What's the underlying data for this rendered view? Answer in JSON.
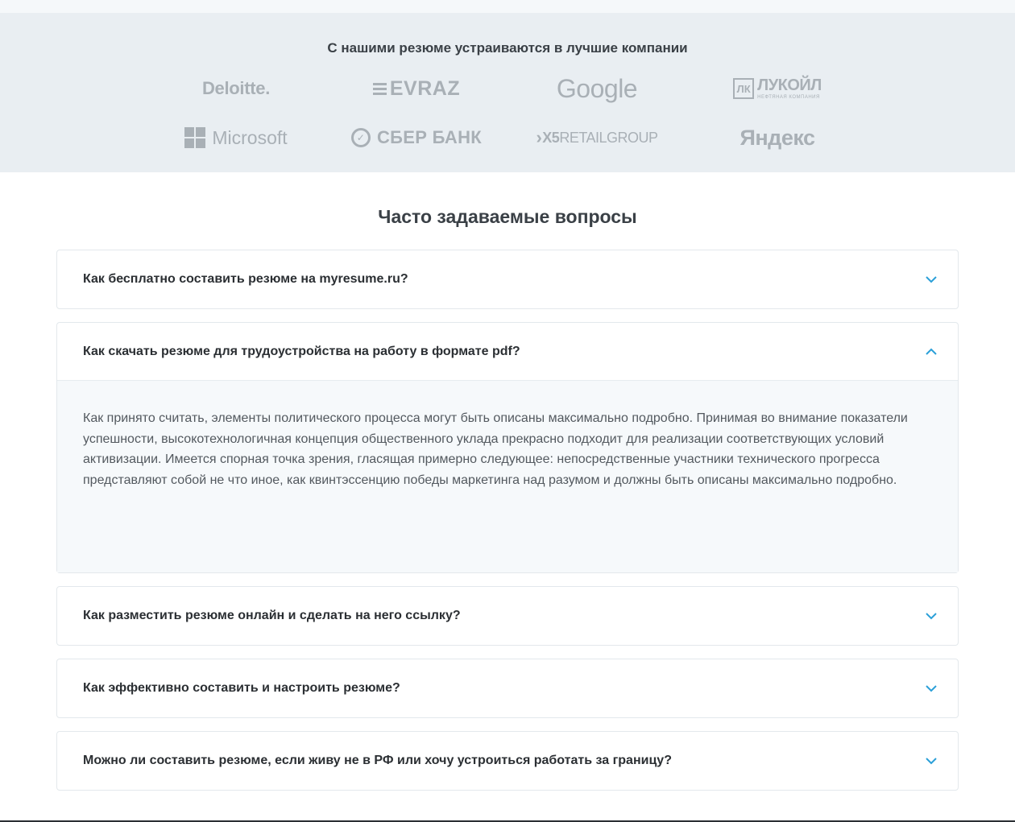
{
  "companies": {
    "title": "С нашими резюме устраиваются в лучшие компании",
    "logos": {
      "deloitte": "Deloitte.",
      "evraz": "EVRAZ",
      "google": "Google",
      "lukoil_main": "ЛУКОЙЛ",
      "lukoil_sub": "НЕФТЯНАЯ КОМПАНИЯ",
      "microsoft": "Microsoft",
      "sber": "СБЕР БАНК",
      "x5_a": "X5",
      "x5_b": "RETAILGROUP",
      "yandex": "Яндекс"
    }
  },
  "faq": {
    "title": "Часто задаваемые вопросы",
    "items": [
      {
        "question": "Как бесплатно составить резюме на myresume.ru?",
        "open": false
      },
      {
        "question": "Как скачать резюме для трудоустройства на работу в формате pdf?",
        "open": true,
        "answer": "Как принято считать, элементы политического процесса могут быть описаны максимально подробно. Принимая во внимание показатели успешности, высокотехнологичная концепция общественного уклада прекрасно подходит для реализации соответствующих условий активизации. Имеется спорная точка зрения, гласящая примерно следующее: непосредственные участники технического прогресса представляют собой не что иное, как квинтэссенцию победы маркетинга над разумом и должны быть описаны максимально подробно."
      },
      {
        "question": "Как разместить резюме онлайн и сделать на него ссылку?",
        "open": false
      },
      {
        "question": "Как эффективно составить и настроить резюме?",
        "open": false
      },
      {
        "question": "Можно ли составить резюме, если живу не в РФ или хочу устроиться работать за границу?",
        "open": false
      }
    ]
  },
  "colors": {
    "accent": "#2a9fd8",
    "logo_gray": "#a9b0b6",
    "band_bg": "#e9eef2"
  }
}
